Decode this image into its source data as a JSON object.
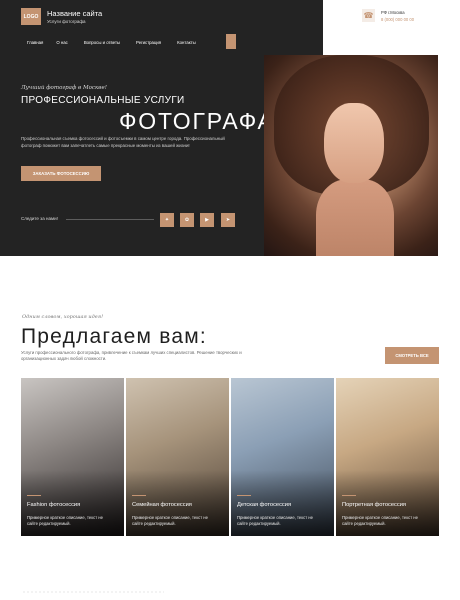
{
  "header": {
    "logo": "LOGO",
    "site_name": "Название сайта",
    "site_sub": "Услуги фотографа",
    "city": "РФ г.Москва",
    "phone": "8 (000) 000 00 00"
  },
  "nav": {
    "items": [
      "Главная",
      "О нас",
      "Вопросы и ответы",
      "Регистрация",
      "Контакты"
    ]
  },
  "hero": {
    "tagline": "Лучший фотограф в Москве!",
    "title_line1": "ПРОФЕССИОНАЛЬНЫЕ УСЛУГИ",
    "title_line2": "ФОТОГРАФА",
    "description": "Профессиональная съемка фотосессий и фотосъемки в самом центре города. Профессиональный фотограф поможет вам запечатлеть самые прекрасные моменты из вашей жизни!",
    "order_button": "ЗАКАЗАТЬ ФОТОСЕССИЮ",
    "follow": "Следите за нами!"
  },
  "social": [
    {
      "icon": "vk-icon",
      "glyph": "✦"
    },
    {
      "icon": "ok-icon",
      "glyph": "✿"
    },
    {
      "icon": "youtube-icon",
      "glyph": "▶"
    },
    {
      "icon": "telegram-icon",
      "glyph": "➤"
    }
  ],
  "offer": {
    "script_text": "Одним словом, хорошая идея!",
    "title": "Предлагаем вам:",
    "description": "Услуги профессионального фотографа, привлечение к съемкам лучших специалистов. Решение творческих и организационных задач любой сложности.",
    "view_all": "СМОТРЕТЬ ВСЕ"
  },
  "cards": [
    {
      "title": "Fashion фотосессия",
      "text": "Примерное краткое описание, текст не сайте редактируемый."
    },
    {
      "title": "Семейная фотосессия",
      "text": "Примерное краткое описание, текст не сайте редактируемый."
    },
    {
      "title": "Детская фотосессия",
      "text": "Примерное краткое описание, текст не сайте редактируемый."
    },
    {
      "title": "Портретная фотосессия",
      "text": "Примерное краткое описание, текст не сайте редактируемый."
    }
  ],
  "colors": {
    "accent": "#c49472",
    "dark": "#232323"
  }
}
